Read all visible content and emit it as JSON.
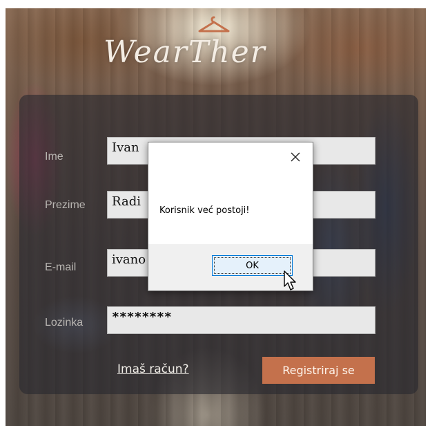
{
  "app": {
    "logo_text": "WearTher",
    "background_desc_icon": "hanger-icon"
  },
  "form": {
    "fields": [
      {
        "label": "Ime",
        "value": "Ivan"
      },
      {
        "label": "Prezime",
        "value": "Radi"
      },
      {
        "label": "E-mail",
        "value": "ivano"
      },
      {
        "label": "Lozinka",
        "value": "********"
      }
    ],
    "link_label": "Imaš račun?",
    "register_label": "Registriraj se"
  },
  "dialog": {
    "message": "Korisnik već postoji!",
    "ok_label": "OK",
    "close_icon": "close-icon"
  },
  "colors": {
    "accent": "#c4714c",
    "panel": "#28282e",
    "dialog_button_border": "#0078d7"
  }
}
